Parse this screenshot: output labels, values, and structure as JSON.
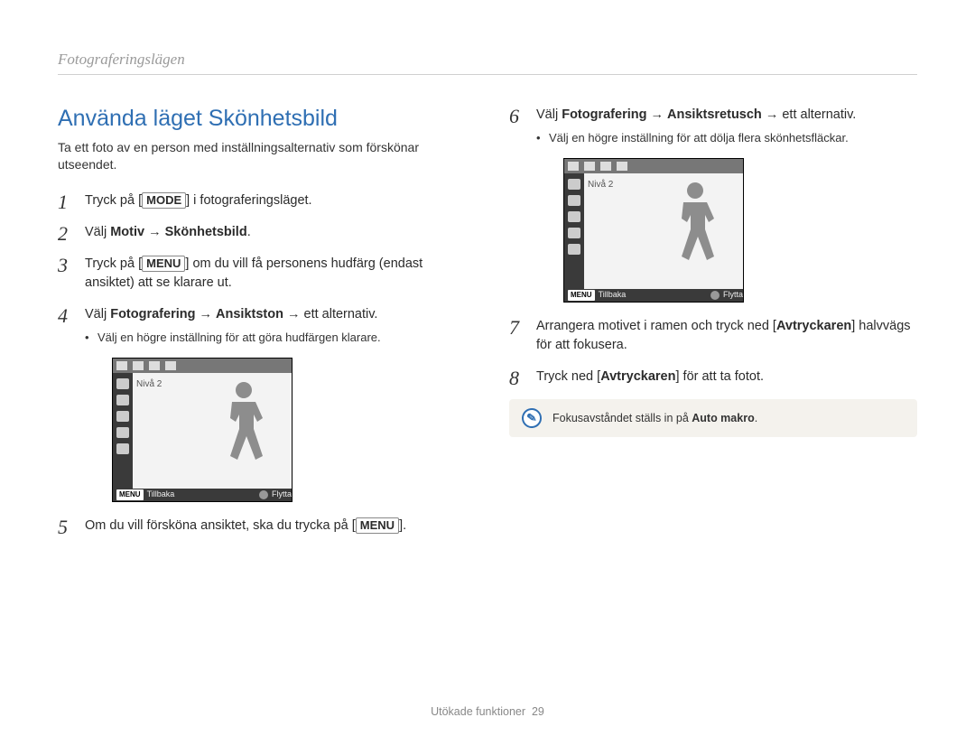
{
  "breadcrumb": "Fotograferingslägen",
  "heading": "Använda läget Skönhetsbild",
  "intro": "Ta ett foto av en person med inställningsalternativ som förskönar utseendet.",
  "buttons": {
    "mode": "MODE",
    "menu": "MENU"
  },
  "bold": {
    "motiv": "Motiv",
    "skonhetsbild": "Skönhetsbild",
    "fotografering": "Fotografering",
    "ansiktston": "Ansiktston",
    "ansiktsretusch": "Ansiktsretusch",
    "avtryckaren": "Avtryckaren",
    "auto_makro": "Auto makro"
  },
  "steps_left": {
    "s1_a": "Tryck på [",
    "s1_b": "] i fotograferingsläget.",
    "s2_a": "Välj ",
    "s2_arrow": " → ",
    "s2_b": ".",
    "s3_a": "Tryck på [",
    "s3_b": "] om du vill få personens hudfärg (endast ansiktet) att se klarare ut.",
    "s4_a": "Välj ",
    "s4_b": " → ett alternativ.",
    "s4_bullet": "Välj en högre inställning för att göra hudfärgen klarare.",
    "s5_a": "Om du vill försköna ansiktet, ska du trycka på [",
    "s5_b": "]."
  },
  "steps_right": {
    "s6_a": "Välj ",
    "s6_b": " → ett alternativ.",
    "s6_bullet": "Välj en högre inställning för att dölja flera skönhetsfläckar.",
    "s7_a": "Arrangera motivet i ramen och tryck ned [",
    "s7_b": "] halvvägs för att fokusera.",
    "s8_a": "Tryck ned [",
    "s8_b": "] för att ta fotot."
  },
  "nums": {
    "n1": "1",
    "n2": "2",
    "n3": "3",
    "n4": "4",
    "n5": "5",
    "n6": "6",
    "n7": "7",
    "n8": "8"
  },
  "preview": {
    "level": "Nivå 2",
    "back": "Tillbaka",
    "move": "Flytta",
    "menu": "MENU"
  },
  "note": "Fokusavståndet ställs in på ",
  "note_end": ".",
  "footer_label": "Utökade funktioner",
  "footer_page": "29"
}
